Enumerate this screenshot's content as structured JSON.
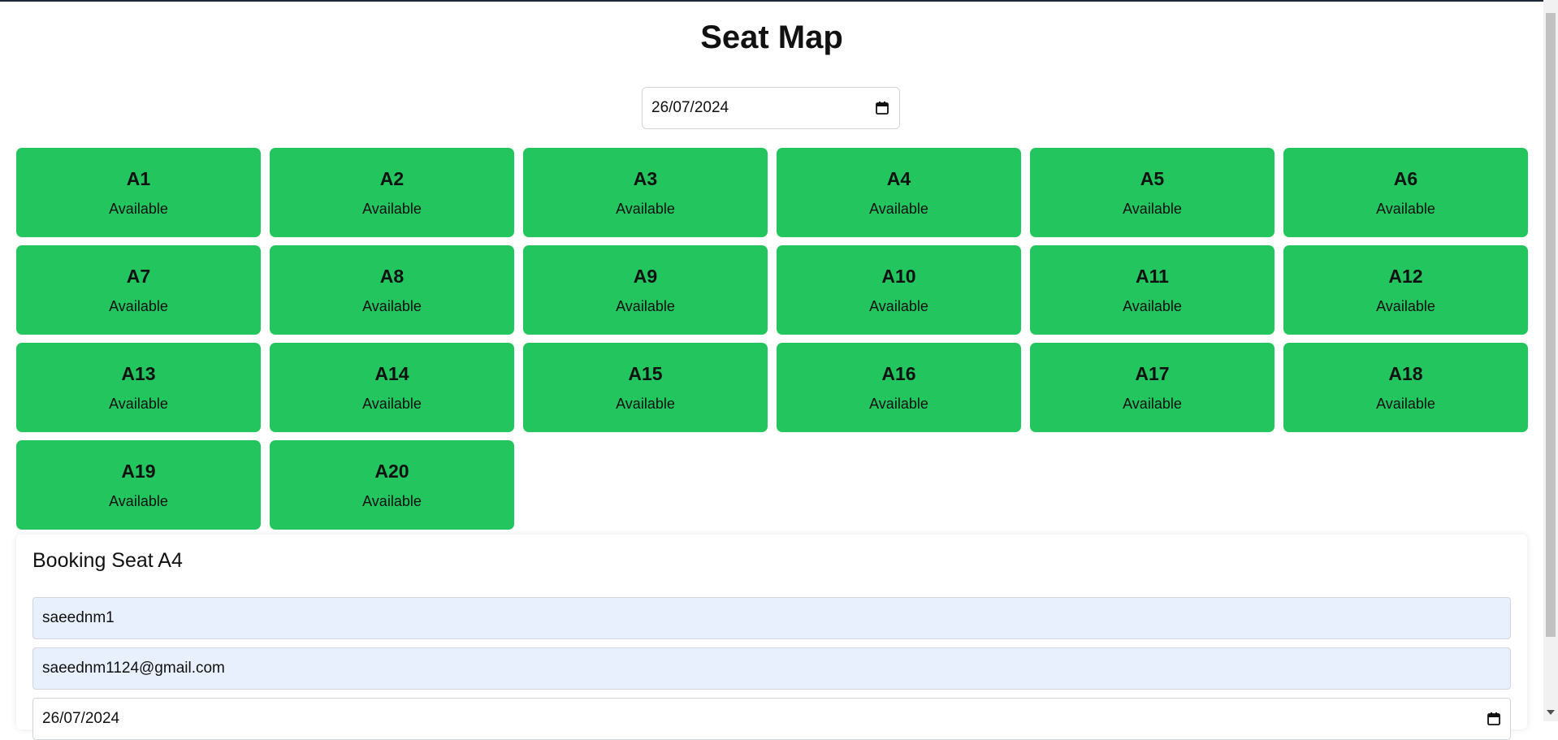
{
  "page": {
    "title": "Seat Map"
  },
  "date_picker": {
    "value": "26/07/2024",
    "icon": "calendar-icon"
  },
  "seats": [
    {
      "id": "A1",
      "status": "Available"
    },
    {
      "id": "A2",
      "status": "Available"
    },
    {
      "id": "A3",
      "status": "Available"
    },
    {
      "id": "A4",
      "status": "Available"
    },
    {
      "id": "A5",
      "status": "Available"
    },
    {
      "id": "A6",
      "status": "Available"
    },
    {
      "id": "A7",
      "status": "Available"
    },
    {
      "id": "A8",
      "status": "Available"
    },
    {
      "id": "A9",
      "status": "Available"
    },
    {
      "id": "A10",
      "status": "Available"
    },
    {
      "id": "A11",
      "status": "Available"
    },
    {
      "id": "A12",
      "status": "Available"
    },
    {
      "id": "A13",
      "status": "Available"
    },
    {
      "id": "A14",
      "status": "Available"
    },
    {
      "id": "A15",
      "status": "Available"
    },
    {
      "id": "A16",
      "status": "Available"
    },
    {
      "id": "A17",
      "status": "Available"
    },
    {
      "id": "A18",
      "status": "Available"
    },
    {
      "id": "A19",
      "status": "Available"
    },
    {
      "id": "A20",
      "status": "Available"
    }
  ],
  "booking": {
    "heading": "Booking Seat A4",
    "name_value": "saeednm1",
    "email_value": "saeednm1124@gmail.com",
    "date_value": "26/07/2024"
  },
  "colors": {
    "available": "#22c55e",
    "autofill": "#e8f0fe"
  }
}
